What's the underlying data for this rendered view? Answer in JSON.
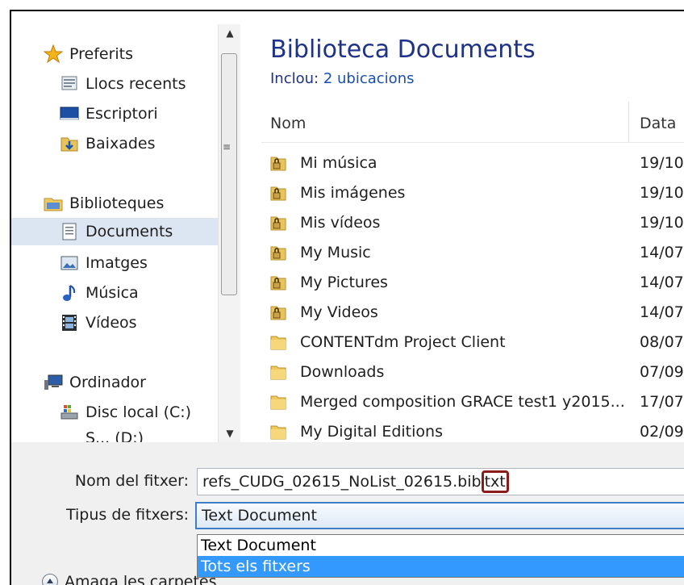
{
  "nav": {
    "favorites": "Preferits",
    "recent": "Llocs recents",
    "desktop": "Escriptori",
    "downloads": "Baixades",
    "libraries": "Biblioteques",
    "documents": "Documents",
    "images": "Imatges",
    "music": "Música",
    "videos": "Vídeos",
    "computer": "Ordinador",
    "local_disk": "Disc local (C:)",
    "partial": "S... (D:)"
  },
  "content": {
    "title": "Biblioteca Documents",
    "includes_label": "Inclou:",
    "includes_link": "2 ubicacions",
    "col_name": "Nom",
    "col_date": "Data",
    "files": [
      {
        "name": "Mi música",
        "date": "19/10",
        "locked": true
      },
      {
        "name": "Mis imágenes",
        "date": "19/10",
        "locked": true
      },
      {
        "name": "Mis vídeos",
        "date": "19/10",
        "locked": true
      },
      {
        "name": "My Music",
        "date": "14/07",
        "locked": true
      },
      {
        "name": "My Pictures",
        "date": "14/07",
        "locked": true
      },
      {
        "name": "My Videos",
        "date": "14/07",
        "locked": true
      },
      {
        "name": "CONTENTdm Project Client",
        "date": "08/07",
        "locked": false
      },
      {
        "name": "Downloads",
        "date": "07/09",
        "locked": false
      },
      {
        "name": "Merged composition GRACE test1 y2015...",
        "date": "17/07",
        "locked": false
      },
      {
        "name": "My Digital Editions",
        "date": "02/09",
        "locked": false
      }
    ]
  },
  "bottom": {
    "filename_label": "Nom del fitxer:",
    "filename_value": "refs_CUDG_02615_NoList_02615.bib",
    "filename_ext": "txt",
    "type_label": "Tipus de fitxers:",
    "type_value": "Text Document",
    "type_options": [
      "Text Document",
      "Tots els fitxers"
    ],
    "hide_folders": "Amaga les carpetes"
  },
  "colors": {
    "title": "#1e3287",
    "selected_option": "#3399ff",
    "highlight_box": "#8b1c1c"
  }
}
